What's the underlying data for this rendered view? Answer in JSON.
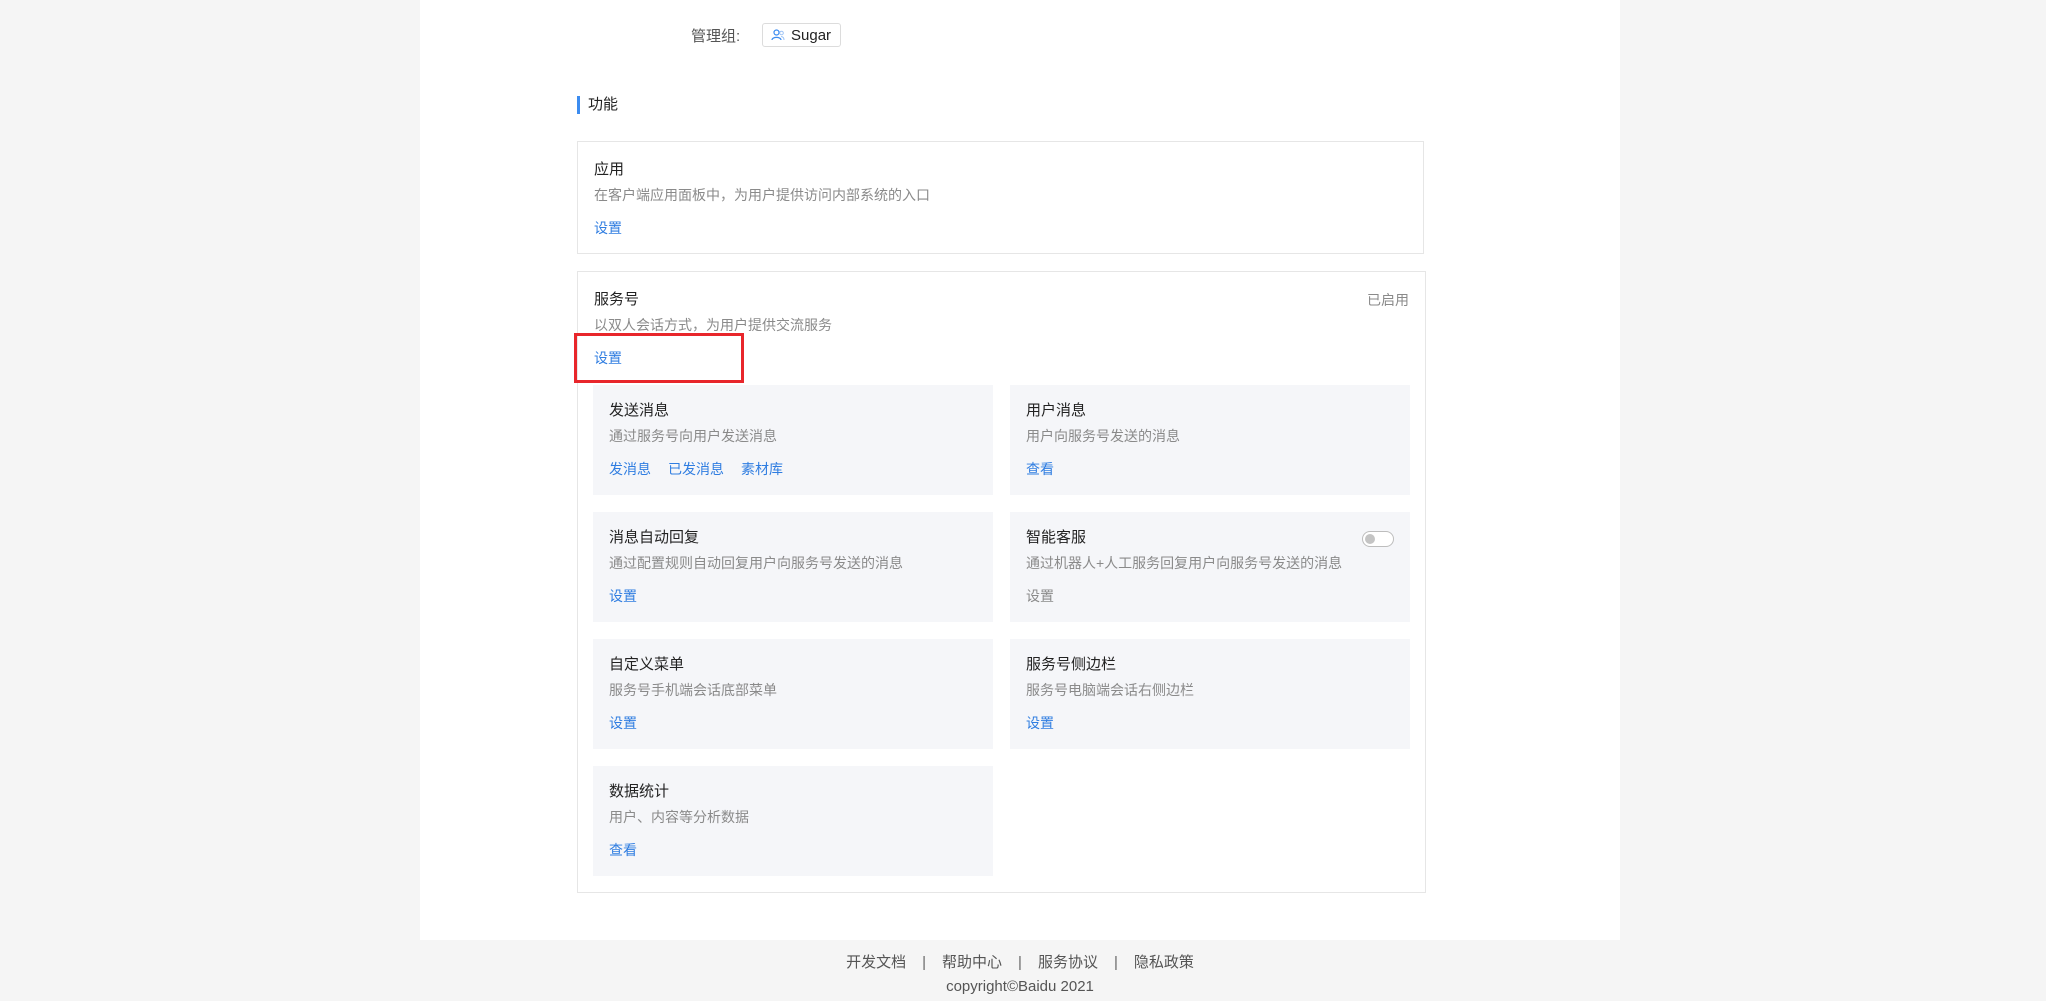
{
  "admin": {
    "label": "管理组:",
    "group_name": "Sugar"
  },
  "section": {
    "title": "功能"
  },
  "app_card": {
    "title": "应用",
    "desc": "在客户端应用面板中，为用户提供访问内部系统的入口",
    "action": "设置"
  },
  "service_card": {
    "title": "服务号",
    "desc": "以双人会话方式，为用户提供交流服务",
    "action": "设置",
    "status": "已启用",
    "features": {
      "send_msg": {
        "title": "发送消息",
        "desc": "通过服务号向用户发送消息",
        "links": [
          "发消息",
          "已发消息",
          "素材库"
        ]
      },
      "user_msg": {
        "title": "用户消息",
        "desc": "用户向服务号发送的消息",
        "links": [
          "查看"
        ]
      },
      "auto_reply": {
        "title": "消息自动回复",
        "desc": "通过配置规则自动回复用户向服务号发送的消息",
        "links": [
          "设置"
        ]
      },
      "smart_service": {
        "title": "智能客服",
        "desc": "通过机器人+人工服务回复用户向服务号发送的消息",
        "links": [
          "设置"
        ],
        "enabled": false
      },
      "custom_menu": {
        "title": "自定义菜单",
        "desc": "服务号手机端会话底部菜单",
        "links": [
          "设置"
        ]
      },
      "sidebar": {
        "title": "服务号侧边栏",
        "desc": "服务号电脑端会话右侧边栏",
        "links": [
          "设置"
        ]
      },
      "stats": {
        "title": "数据统计",
        "desc": "用户、内容等分析数据",
        "links": [
          "查看"
        ]
      }
    }
  },
  "footer": {
    "links": [
      "开发文档",
      "帮助中心",
      "服务协议",
      "隐私政策"
    ],
    "separator": "|",
    "copyright": "copyright©Baidu 2021"
  },
  "colors": {
    "accent": "#2f7de1",
    "highlight": "#e8262b",
    "subcard_bg": "#f5f6f9"
  }
}
